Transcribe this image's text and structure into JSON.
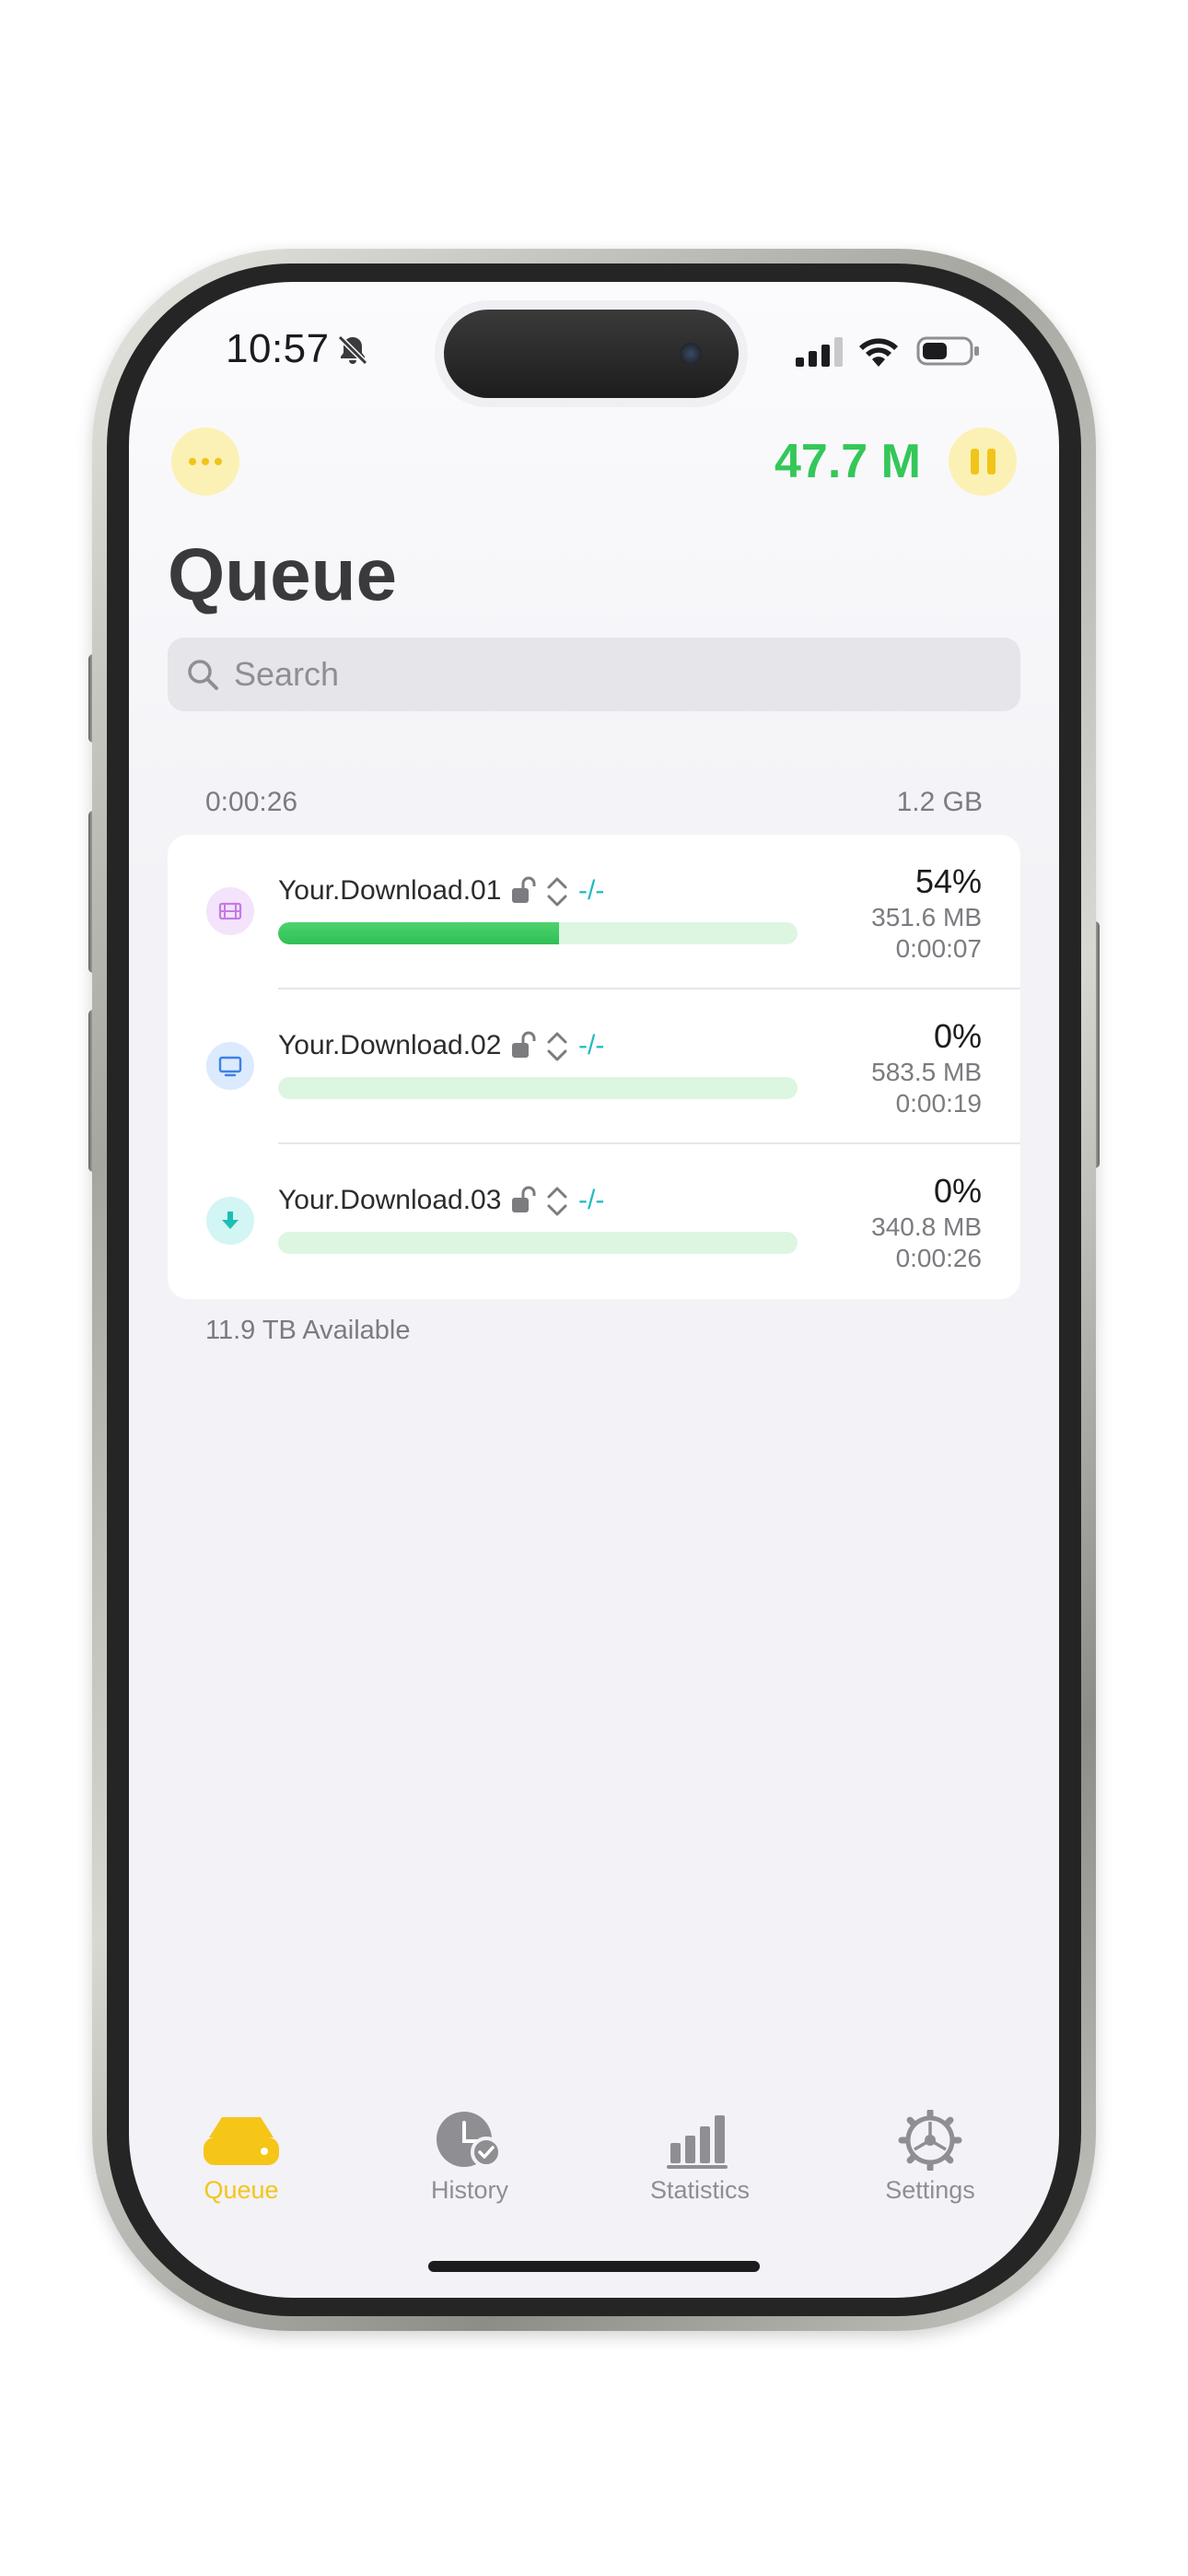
{
  "status_bar": {
    "time": "10:57"
  },
  "header": {
    "more_icon": "ellipsis-icon",
    "speed": "47.7 M",
    "pause_icon": "pause-icon",
    "title": "Queue"
  },
  "search": {
    "placeholder": "Search"
  },
  "queue_summary": {
    "total_time": "0:00:26",
    "total_size": "1.2 GB"
  },
  "downloads": [
    {
      "name": "Your.Download.01",
      "type_icon": "film-icon",
      "ratio": "-/-",
      "percent": "54%",
      "progress": 0.54,
      "size": "351.6 MB",
      "eta": "0:00:07"
    },
    {
      "name": "Your.Download.02",
      "type_icon": "monitor-icon",
      "ratio": "-/-",
      "percent": "0%",
      "progress": 0,
      "size": "583.5 MB",
      "eta": "0:00:19"
    },
    {
      "name": "Your.Download.03",
      "type_icon": "download-arrow-icon",
      "ratio": "-/-",
      "percent": "0%",
      "progress": 0,
      "size": "340.8 MB",
      "eta": "0:00:26"
    }
  ],
  "storage": {
    "available": "11.9 TB Available"
  },
  "tabs": [
    {
      "label": "Queue",
      "icon": "drive-icon",
      "active": true
    },
    {
      "label": "History",
      "icon": "clock-check-icon",
      "active": false
    },
    {
      "label": "Statistics",
      "icon": "bar-chart-icon",
      "active": false
    },
    {
      "label": "Settings",
      "icon": "gear-icon",
      "active": false
    }
  ],
  "colors": {
    "accent_yellow": "#F5C518",
    "speed_green": "#34C759",
    "progress_green": "#34C759",
    "ratio_teal": "#22BBC3"
  }
}
